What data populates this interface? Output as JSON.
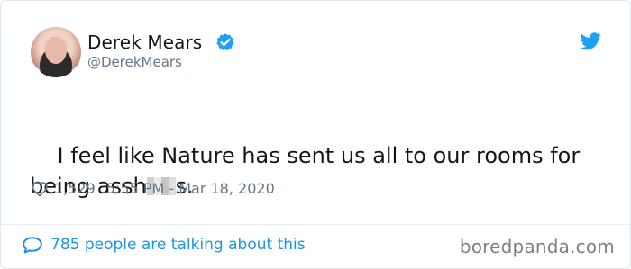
{
  "tweet": {
    "display_name": "Derek Mears",
    "handle": "@DerekMears",
    "text_before_redaction": "I feel like Nature has sent us all to our rooms for being assh",
    "text_after_redaction": "s.",
    "likes": "1,529",
    "timestamp": "5:55 PM - Mar 18, 2020",
    "conversation_text": "785 people are talking about this"
  },
  "watermark": {
    "text": "boredpanda.com"
  },
  "colors": {
    "twitter_blue": "#1da1f2",
    "link_blue": "#1b95e0",
    "meta_gray": "#657786",
    "text_black": "#14171a",
    "border_gray": "#e1e8ed"
  },
  "icons": {
    "verified": "verified-badge-icon",
    "brand": "twitter-bird-icon",
    "like": "heart-outline-icon",
    "conversation": "speech-bubble-icon"
  }
}
